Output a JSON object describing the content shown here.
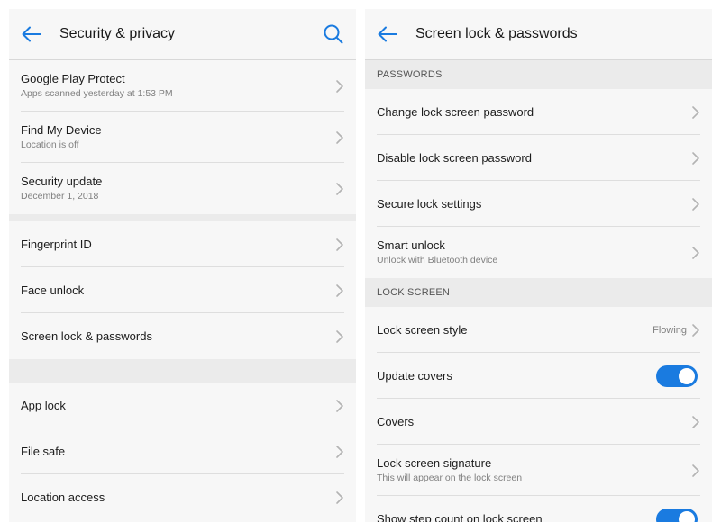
{
  "left": {
    "title": "Security & privacy",
    "groups": [
      [
        {
          "title": "Google Play Protect",
          "subtitle": "Apps scanned yesterday at 1:53 PM"
        },
        {
          "title": "Find My Device",
          "subtitle": "Location is off"
        },
        {
          "title": "Security update",
          "subtitle": "December 1, 2018"
        }
      ],
      [
        {
          "title": "Fingerprint ID"
        },
        {
          "title": "Face unlock"
        },
        {
          "title": "Screen lock & passwords"
        }
      ],
      [
        {
          "title": "App lock"
        },
        {
          "title": "File safe"
        },
        {
          "title": "Location access"
        }
      ]
    ]
  },
  "right": {
    "title": "Screen lock & passwords",
    "sections": [
      {
        "header": "PASSWORDS",
        "items": [
          {
            "title": "Change lock screen password"
          },
          {
            "title": "Disable lock screen password"
          },
          {
            "title": "Secure lock settings"
          },
          {
            "title": "Smart unlock",
            "subtitle": "Unlock with Bluetooth device"
          }
        ]
      },
      {
        "header": "LOCK SCREEN",
        "items": [
          {
            "title": "Lock screen style",
            "value": "Flowing"
          },
          {
            "title": "Update covers",
            "toggle": true
          },
          {
            "title": "Covers"
          },
          {
            "title": "Lock screen signature",
            "subtitle": "This will appear on the lock screen"
          },
          {
            "title": "Show step count on lock screen",
            "toggle": true
          }
        ]
      }
    ]
  },
  "colors": {
    "accent": "#1a7be0",
    "background": "#f7f7f7",
    "section_background": "#ebebeb",
    "divider": "#dedede",
    "text": "#1c1c1c",
    "secondary_text": "#808080"
  }
}
